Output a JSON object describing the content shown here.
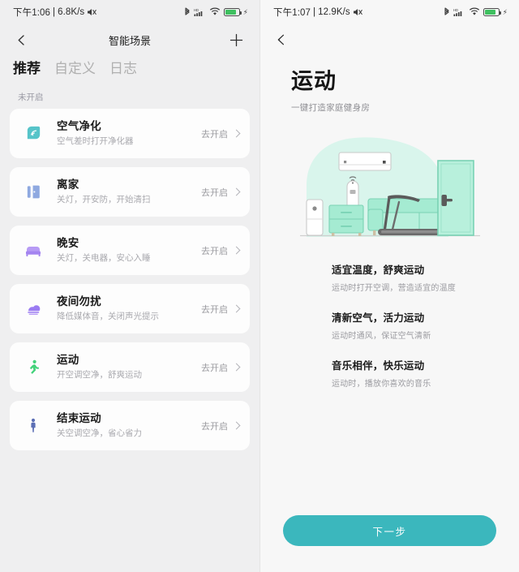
{
  "left": {
    "statusbar": {
      "time": "下午1:06",
      "separator": "|",
      "netspeed": "6.8K/s",
      "icons": [
        "mute-icon",
        "bluetooth-icon",
        "hd-signal-icon",
        "wifi-icon",
        "battery-charging-icon",
        "charging-bolt-icon"
      ]
    },
    "appbar": {
      "back": "back-arrow-icon",
      "title": "智能场景",
      "add": "plus-icon"
    },
    "tabs": [
      {
        "label": "推荐",
        "active": true
      },
      {
        "label": "自定义",
        "active": false
      },
      {
        "label": "日志",
        "active": false
      }
    ],
    "section_label": "未开启",
    "action_label": "去开启",
    "scenes": [
      {
        "title": "空气净化",
        "subtitle": "空气差时打开净化器",
        "action": "去开启",
        "icon": "air-purifier-leaf-icon",
        "color": "#56c4c9"
      },
      {
        "title": "离家",
        "subtitle": "关灯，开安防，开始清扫",
        "action": "去开启",
        "icon": "door-leaving-icon",
        "color": "#8fa9e0"
      },
      {
        "title": "晚安",
        "subtitle": "关灯，关电器，安心入睡",
        "action": "去开启",
        "icon": "bed-icon",
        "color": "#a484f0"
      },
      {
        "title": "夜间勿扰",
        "subtitle": "降低媒体音，关闭声光提示",
        "action": "去开启",
        "icon": "moon-cloud-icon",
        "color": "#9b7cf2"
      },
      {
        "title": "运动",
        "subtitle": "开空调空净，舒爽运动",
        "action": "去开启",
        "icon": "running-person-icon",
        "color": "#43d27a"
      },
      {
        "title": "结束运动",
        "subtitle": "关空调空净，省心省力",
        "action": "去开启",
        "icon": "standing-person-icon",
        "color": "#5c6fb5"
      }
    ]
  },
  "right": {
    "statusbar": {
      "time": "下午1:07",
      "separator": "|",
      "netspeed": "12.9K/s",
      "icons": [
        "mute-icon",
        "bluetooth-icon",
        "hd-signal-icon",
        "wifi-icon",
        "battery-charging-icon",
        "charging-bolt-icon"
      ]
    },
    "appbar": {
      "back": "back-arrow-icon"
    },
    "title": "运动",
    "subtitle": "一键打造家庭健身房",
    "illustration": "home-gym-room-illustration",
    "features": [
      {
        "title": "适宜温度，舒爽运动",
        "desc": "运动时打开空调，营造适宜的温度"
      },
      {
        "title": "清新空气，活力运动",
        "desc": "运动时通风，保证空气清新"
      },
      {
        "title": "音乐相伴，快乐运动",
        "desc": "运动时，播放你喜欢的音乐"
      }
    ],
    "next_button": "下一步"
  },
  "colors": {
    "accent": "#3bb7bd",
    "left_bg": "#efeff0",
    "right_bg": "#f7f7f7",
    "card_bg": "#fdfdfd",
    "mint": "#a5ebd2",
    "battery_green": "#3fc060"
  }
}
